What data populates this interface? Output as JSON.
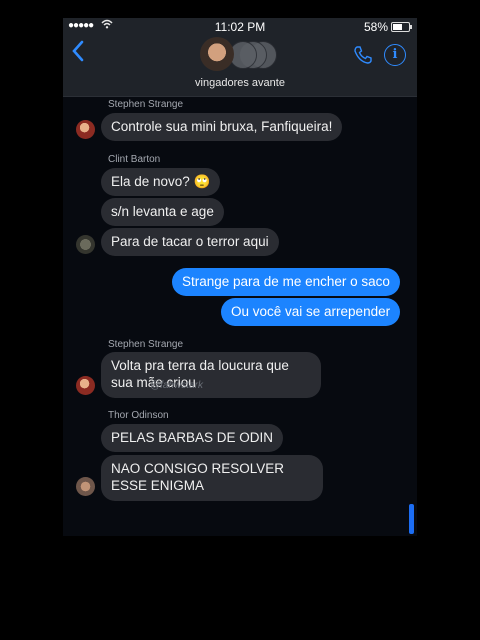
{
  "status_bar": {
    "signal": "●●●●●",
    "time": "11:02 PM",
    "battery": "58%",
    "battery_level": 0.58
  },
  "header": {
    "group_name": "vingadores avante"
  },
  "icons": {
    "back": "chevron-left-icon",
    "call": "phone-icon",
    "info": "info-icon",
    "wifi": "wifi-icon"
  },
  "colors": {
    "accent": "#2f8bff",
    "outgoing": "#1c84ff",
    "incoming": "#2a2c32"
  },
  "messages": {
    "g1_sender": "Stephen Strange",
    "g1_m1": "Controle sua mini bruxa, Fanfiqueira!",
    "g2_sender": "Clint Barton",
    "g2_m1": "Ela de novo? 🙄",
    "g2_m2": "s/n levanta e age",
    "g2_m3": "Para de tacar o terror aqui",
    "out_m1": "Strange para de me encher o saco",
    "out_m2": "Ou você vai se arrepender",
    "g3_sender": "Stephen Strange",
    "g3_m1": "Volta pra terra da loucura que sua mãe criou",
    "g4_sender": "Thor Odinson",
    "g4_m1": "PELAS BARBAS DE ODIN",
    "g4_m2": "NAO CONSIGO RESOLVER ESSE ENIGMA"
  },
  "watermark": "@fahwstark"
}
